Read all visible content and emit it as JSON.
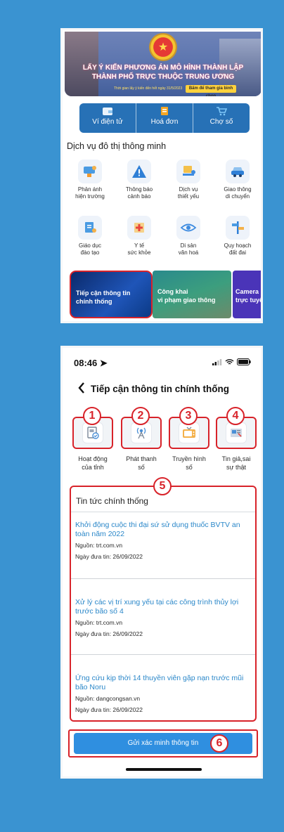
{
  "phone1": {
    "banner": {
      "line1": "LẤY Ý KIẾN PHƯƠNG ÁN MÔ HÌNH THÀNH LẬP",
      "line2": "THÀNH PHỐ TRỰC THUỘC TRUNG ƯƠNG",
      "deadline": "Thời gian lấy ý kiến đến hết ngày 31/5/2023",
      "cta": "Bấm để tham gia bình chọn"
    },
    "tabs": [
      {
        "label": "Ví điện tử",
        "icon": "wallet-icon"
      },
      {
        "label": "Hoá đơn",
        "icon": "invoice-icon"
      },
      {
        "label": "Chợ số",
        "icon": "cart-icon"
      }
    ],
    "section_title": "Dịch vụ đô thị thông minh",
    "services": [
      {
        "label1": "Phản ánh",
        "label2": "hiện trường",
        "icon": "feedback-icon"
      },
      {
        "label1": "Thông báo",
        "label2": "cảnh báo",
        "icon": "warning-icon"
      },
      {
        "label1": "Dịch vụ",
        "label2": "thiết yếu",
        "icon": "essential-service-icon"
      },
      {
        "label1": "Giao thông",
        "label2": "di chuyển",
        "icon": "car-icon"
      },
      {
        "label1": "Giáo dục",
        "label2": "đào tạo",
        "icon": "education-icon"
      },
      {
        "label1": "Y tế",
        "label2": "sức khỏe",
        "icon": "health-icon"
      },
      {
        "label1": "Di sản",
        "label2": "văn hoá",
        "icon": "heritage-icon"
      },
      {
        "label1": "Quy hoạch",
        "label2": "đất đai",
        "icon": "planning-icon"
      }
    ],
    "cards": [
      {
        "line1": "Tiếp cận thông tin",
        "line2": "chính thống"
      },
      {
        "line1": "Công khai",
        "line2": "vi phạm giao thông"
      },
      {
        "line1": "Camera",
        "line2": "trực tuyế"
      }
    ]
  },
  "phone2": {
    "time": "08:46",
    "title": "Tiếp cận thông tin chính thống",
    "functions": [
      {
        "badge": "1",
        "label1": "Hoạt động",
        "label2": "của tỉnh",
        "icon": "document-check-icon"
      },
      {
        "badge": "2",
        "label1": "Phát thanh",
        "label2": "số",
        "icon": "radio-tower-icon"
      },
      {
        "badge": "3",
        "label1": "Truyền hình",
        "label2": "số",
        "icon": "tv-icon"
      },
      {
        "badge": "4",
        "label1": "Tin giả,sai",
        "label2": "sự thật",
        "icon": "news-icon"
      }
    ],
    "news_badge": "5",
    "news_heading": "Tin tức chính thống",
    "news": [
      {
        "title": "Khởi động cuộc thi đại sứ sử dụng thuốc BVTV an toàn năm 2022",
        "source": "Nguồn: trt.com.vn",
        "date": "Ngày đưa tin: 26/09/2022"
      },
      {
        "title": "Xử lý các vị trí xung yếu tại các công trình thủy lợi trước bão số 4",
        "source": "Nguồn: trt.com.vn",
        "date": "Ngày đưa tin: 26/09/2022"
      },
      {
        "title": "Ứng cứu kịp thời 14 thuyền viên gặp nạn trước mũi bão Noru",
        "source": "Nguồn: dangcongsan.vn",
        "date": "Ngày đưa tin: 26/09/2022"
      }
    ],
    "submit_label": "Gửi xác minh thông tin",
    "submit_badge": "6"
  }
}
